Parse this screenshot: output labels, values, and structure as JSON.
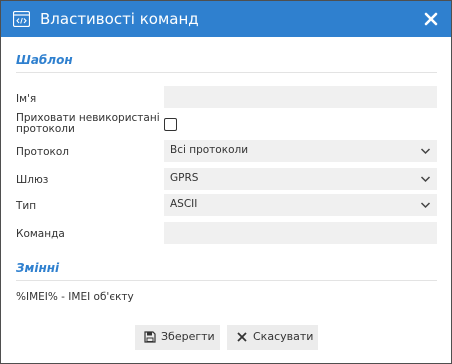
{
  "dialog": {
    "title": "Властивості команд"
  },
  "template_section": {
    "heading": "Шаблон",
    "name_label": "Ім'я",
    "name_value": "",
    "hide_unused_label": "Приховати невикористані протоколи",
    "hide_unused_checked": false,
    "protocol_label": "Протокол",
    "protocol_value": "Всі протоколи",
    "gateway_label": "Шлюз",
    "gateway_value": "GPRS",
    "type_label": "Тип",
    "type_value": "ASCII",
    "command_label": "Команда",
    "command_value": ""
  },
  "variables_section": {
    "heading": "Змінні",
    "items": [
      "%IMEI% - IMEI об'єкту"
    ]
  },
  "buttons": {
    "save_label": "Зберегти",
    "cancel_label": "Скасувати"
  },
  "icons": {
    "title": "command-window-icon",
    "close": "close-icon",
    "save": "floppy-disk-icon",
    "cancel": "x-icon",
    "dropdown": "chevron-down-icon"
  },
  "colors": {
    "accent": "#2f80cf",
    "field_bg": "#f0f0f0",
    "button_bg": "#ececec"
  }
}
